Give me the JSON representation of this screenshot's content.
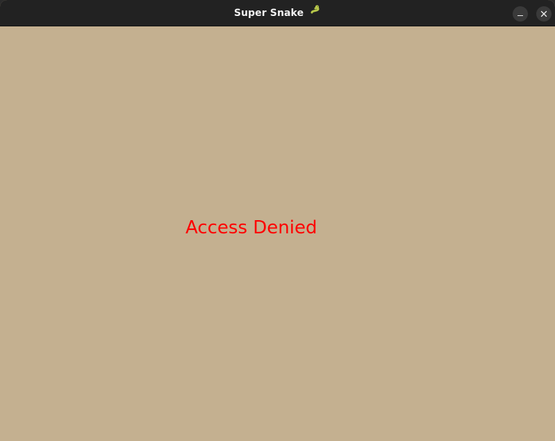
{
  "window": {
    "title": "Super Snake",
    "title_icon": "snake-icon",
    "controls": {
      "minimize_icon": "minimize-icon",
      "close_icon": "close-icon"
    }
  },
  "game": {
    "message": "Access Denied",
    "message_color": "#ff0000",
    "background_color": "#c4b090"
  },
  "colors": {
    "titlebar": "#222222",
    "title_text": "#f2f2f2",
    "snake_icon": "#b8c84a"
  }
}
